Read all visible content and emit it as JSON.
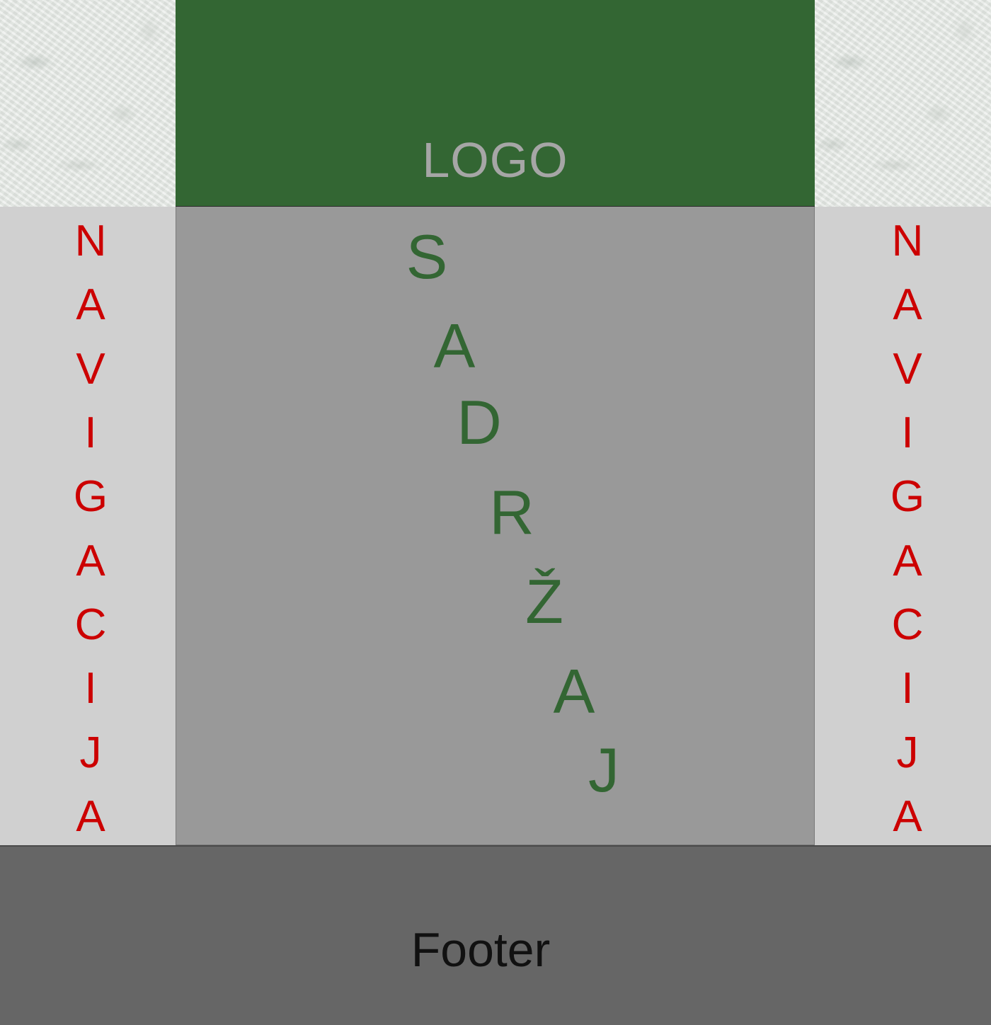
{
  "header": {
    "logo": "LOGO"
  },
  "nav_left": {
    "letters": [
      "N",
      "A",
      "V",
      "I",
      "G",
      "A",
      "C",
      "I",
      "J",
      "A"
    ]
  },
  "nav_right": {
    "letters": [
      "N",
      "A",
      "V",
      "I",
      "G",
      "A",
      "C",
      "I",
      "J",
      "A"
    ]
  },
  "content": {
    "letters": [
      "S",
      "A",
      "D",
      "R",
      "Ž",
      "A",
      "J"
    ]
  },
  "footer": {
    "text": "Footer"
  },
  "colors": {
    "header_bg": "#336633",
    "logo_text": "#a6a6a6",
    "nav_bg": "#d0d0d0",
    "nav_text": "#cc0000",
    "content_bg": "#999999",
    "content_text": "#336633",
    "footer_bg": "#666666",
    "footer_text": "#111111"
  }
}
